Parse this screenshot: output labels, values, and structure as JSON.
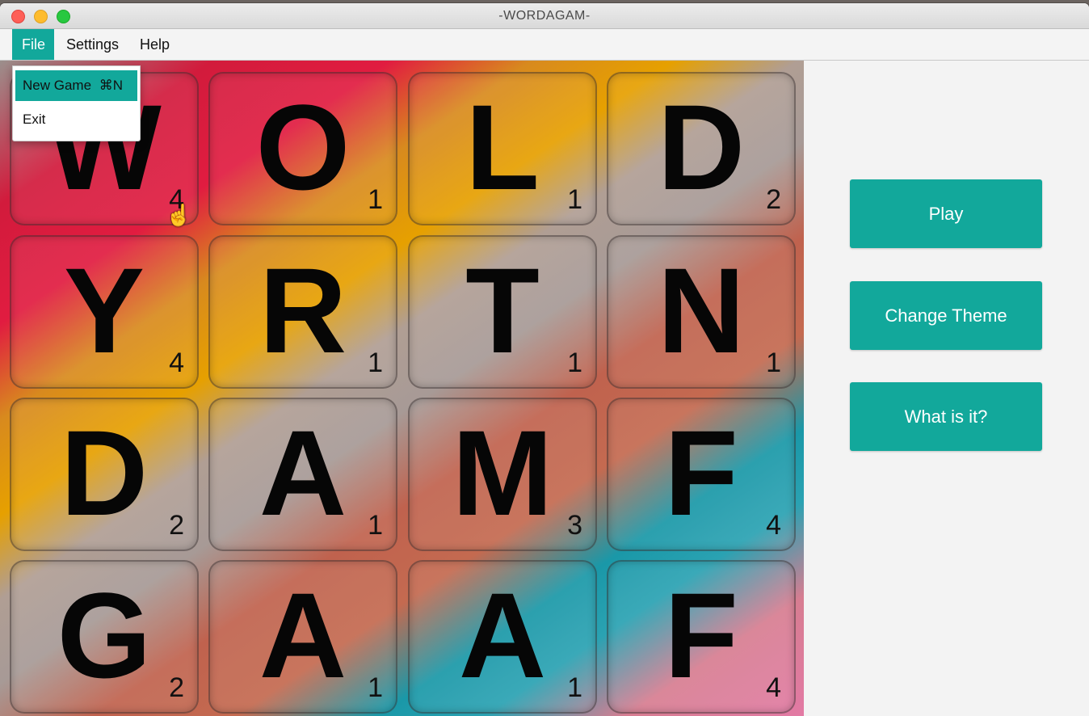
{
  "window": {
    "title": "-WORDAGAM-"
  },
  "menu": {
    "file": "File",
    "settings": "Settings",
    "help": "Help"
  },
  "file_menu": {
    "new_game": "New Game",
    "new_game_shortcut": "⌘N",
    "exit": "Exit"
  },
  "board": {
    "tiles": [
      {
        "letter": "W",
        "score": "4"
      },
      {
        "letter": "O",
        "score": "1"
      },
      {
        "letter": "L",
        "score": "1"
      },
      {
        "letter": "D",
        "score": "2"
      },
      {
        "letter": "Y",
        "score": "4"
      },
      {
        "letter": "R",
        "score": "1"
      },
      {
        "letter": "T",
        "score": "1"
      },
      {
        "letter": "N",
        "score": "1"
      },
      {
        "letter": "D",
        "score": "2"
      },
      {
        "letter": "A",
        "score": "1"
      },
      {
        "letter": "M",
        "score": "3"
      },
      {
        "letter": "F",
        "score": "4"
      },
      {
        "letter": "G",
        "score": "2"
      },
      {
        "letter": "A",
        "score": "1"
      },
      {
        "letter": "A",
        "score": "1"
      },
      {
        "letter": "F",
        "score": "4"
      }
    ]
  },
  "side_panel": {
    "play": "Play",
    "change_theme": "Change Theme",
    "what_is_it": "What is it?"
  },
  "colors": {
    "accent": "#12a89b"
  }
}
